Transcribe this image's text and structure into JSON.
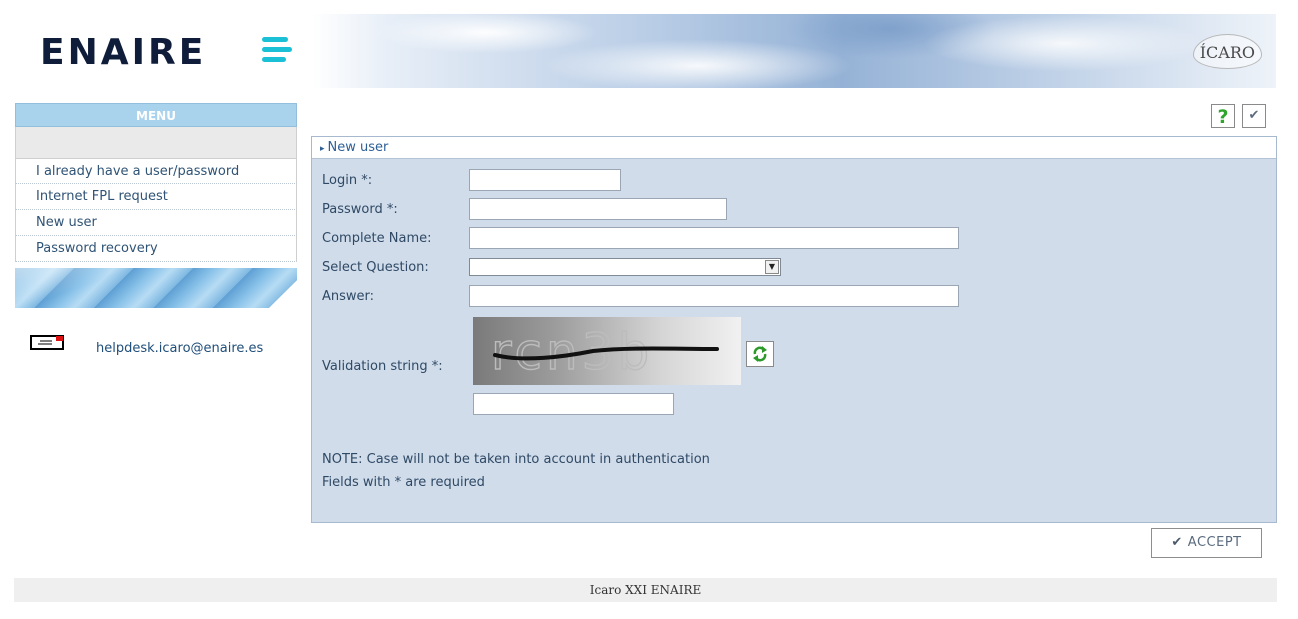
{
  "header": {
    "logo_text": "ENAIRE",
    "badge_text": "ÍCARO"
  },
  "sidebar": {
    "menu_title": "MENU",
    "items": [
      {
        "label": "I already have a user/password"
      },
      {
        "label": "Internet FPL request"
      },
      {
        "label": "New user"
      },
      {
        "label": "Password recovery"
      }
    ],
    "email": "helpdesk.icaro@enaire.es"
  },
  "toolbar": {
    "help_label": "?",
    "check_label": "✔"
  },
  "form": {
    "title": "New user",
    "login_label": "Login *:",
    "login_value": "",
    "password_label": "Password *:",
    "password_value": "",
    "name_label": "Complete Name:",
    "name_value": "",
    "question_label": "Select Question:",
    "question_value": "",
    "answer_label": "Answer:",
    "answer_value": "",
    "validation_label": "Validation string *:",
    "captcha_text": "rcn3b",
    "validation_value": "",
    "note1": "NOTE: Case will not be taken into account in authentication",
    "note2": "Fields with * are required",
    "accept_label": "ACCEPT"
  },
  "footer": {
    "text": "Icaro XXI ENAIRE"
  },
  "colors": {
    "panel_bg": "#d1dcea",
    "menu_header": "#a9d2ec",
    "brand_bars": "#19c0d6",
    "link": "#1f4e7a"
  }
}
